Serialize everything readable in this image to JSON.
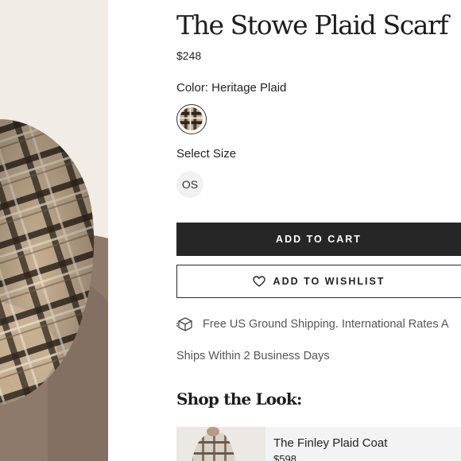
{
  "product": {
    "title": "The Stowe Plaid Scarf",
    "price": "$248",
    "color_label": "Color: Heritage Plaid",
    "size_label": "Select Size",
    "sizes": [
      "OS"
    ],
    "image_alt": "plaid scarf photo"
  },
  "actions": {
    "add_to_cart": "ADD TO CART",
    "add_to_wishlist": "ADD TO WISHLIST",
    "wishlist_icon": "heart-icon"
  },
  "shipping": {
    "icon": "box-icon",
    "text": "Free US Ground Shipping. International Rates A",
    "ships_within": "Ships Within 2 Business Days"
  },
  "shop_the_look": {
    "heading": "Shop the Look:",
    "items": [
      {
        "name": "The Finley Plaid Coat",
        "price": "$598"
      }
    ]
  },
  "colors": {
    "button_dark": "#262626",
    "chip_bg": "#f1f1f1",
    "muted_text": "#555555"
  }
}
